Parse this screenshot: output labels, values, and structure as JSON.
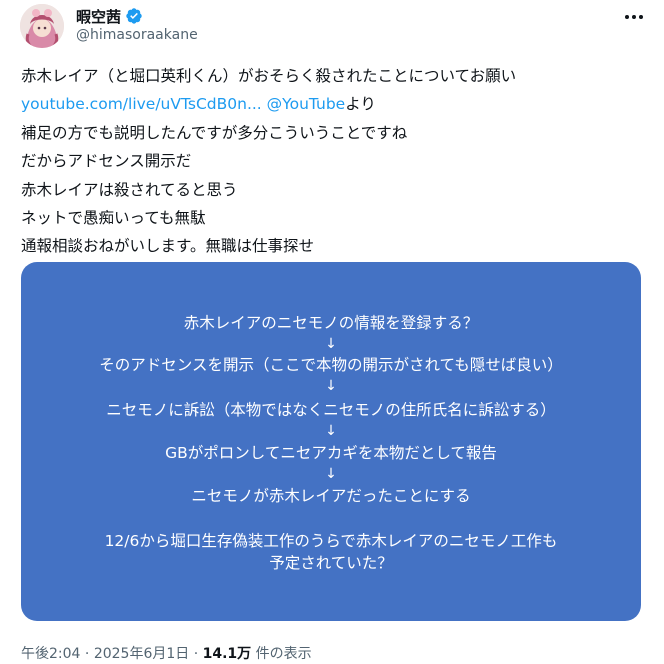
{
  "author": {
    "display_name": "暇空茜",
    "handle": "@himasoraakane",
    "verified": true,
    "verified_color": "#1d9bf0"
  },
  "icons": {
    "avatar": "avatar-image",
    "verified": "verified-badge-icon",
    "more": "more-options-icon"
  },
  "tweet": {
    "line1": "赤木レイア（と堀口英利くん）がおそらく殺されたことについてお願い",
    "link_url": "youtube.com/live/uVTsCdB0n...",
    "link_mention": "@YouTube",
    "link_suffix": "より",
    "line3": "補足の方でも説明したんですが多分こういうことですね",
    "line4": "だからアドセンス開示だ",
    "line5": "赤木レイアは殺されてると思う",
    "line6": "ネットで愚痴いっても無駄",
    "line7": "通報相談おねがいします。無職は仕事探せ"
  },
  "card": {
    "background": "#4472c4",
    "step1": "赤木レイアのニセモノの情報を登録する？",
    "step2": "そのアドセンスを開示（ここで本物の開示がされても隠せば良い）",
    "step3": "ニセモノに訴訟（本物ではなくニセモノの住所氏名に訴訟する）",
    "step4": "GBがポロンしてニセアカギを本物だとして報告",
    "step5": "ニセモノが赤木レイアだったことにする",
    "note_line1": "12/6から堀口生存偽装工作のうらで赤木レイアのニセモノ工作も",
    "note_line2": "予定されていた？",
    "arrow": "↓"
  },
  "meta": {
    "time": "午後2:04",
    "sep1": " · ",
    "date": "2025年6月1日",
    "sep2": " · ",
    "views": "14.1万",
    "views_suffix": " 件の表示"
  }
}
